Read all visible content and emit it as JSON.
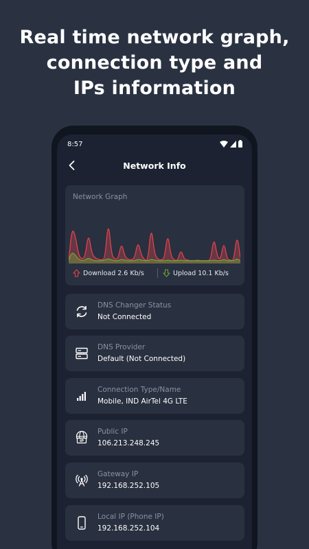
{
  "headline": {
    "line1": "Real time network graph,",
    "line2": "connection type and",
    "line3": "IPs information"
  },
  "status_bar": {
    "time": "8:57",
    "icons": [
      "wifi-icon",
      "signal-icon",
      "battery-icon"
    ]
  },
  "app_bar": {
    "back_icon": "chevron-left-icon",
    "title": "Network Info"
  },
  "graph": {
    "label": "Network Graph",
    "download_label": "Download 2.6 Kb/s",
    "upload_label": "Upload 10.1 Kb/s",
    "colors": {
      "download": "#e0434c",
      "upload": "#6fa23a"
    },
    "chart_data": {
      "type": "area",
      "series": [
        {
          "name": "Download",
          "values": [
            2,
            48,
            38,
            10,
            4,
            8,
            42,
            12,
            6,
            4,
            3,
            5,
            60,
            10,
            4,
            5,
            28,
            8,
            4,
            3,
            6,
            30,
            10,
            3,
            2,
            52,
            12,
            4,
            3,
            5,
            42,
            8,
            3,
            2,
            18,
            4,
            3,
            2,
            2,
            3,
            2,
            2,
            2,
            3,
            36,
            8,
            3,
            30,
            4,
            3,
            2,
            40,
            6
          ]
        },
        {
          "name": "Upload",
          "values": [
            3,
            14,
            10,
            4,
            2,
            3,
            6,
            3,
            2,
            2,
            2,
            3,
            5,
            3,
            2,
            2,
            4,
            3,
            2,
            2,
            2,
            4,
            3,
            2,
            2,
            4,
            3,
            2,
            2,
            2,
            3,
            2,
            2,
            2,
            3,
            2,
            2,
            2,
            2,
            2,
            2,
            2,
            2,
            2,
            3,
            2,
            2,
            4,
            2,
            2,
            2,
            5,
            2
          ]
        }
      ]
    }
  },
  "items": [
    {
      "label": "DNS Changer Status",
      "value": "Not Connected",
      "icon": "sync-icon"
    },
    {
      "label": "DNS Provider",
      "value": "Default (Not Connected)",
      "icon": "server-icon"
    },
    {
      "label": "Connection Type/Name",
      "value": "Mobile, IND AirTel 4G LTE",
      "icon": "signal-bars-icon"
    },
    {
      "label": "Public IP",
      "value": "106.213.248.245",
      "icon": "globe-ip-icon"
    },
    {
      "label": "Gateway IP",
      "value": "192.168.252.105",
      "icon": "antenna-icon"
    },
    {
      "label": "Local IP (Phone IP)",
      "value": "192.168.252.104",
      "icon": "phone-icon"
    }
  ]
}
